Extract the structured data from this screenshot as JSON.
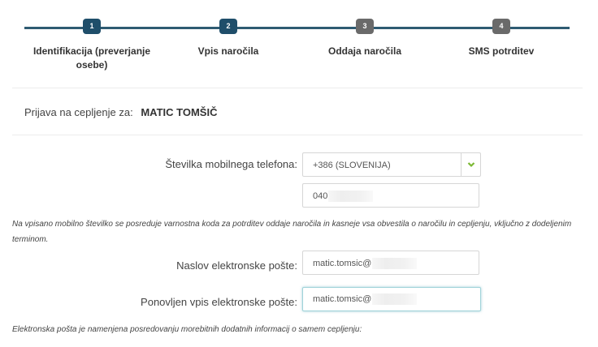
{
  "steps": [
    {
      "number": "1",
      "label": "Identifikacija (preverjanje osebe)",
      "active": true
    },
    {
      "number": "2",
      "label": "Vpis naročila",
      "active": true
    },
    {
      "number": "3",
      "label": "Oddaja naročila",
      "active": false
    },
    {
      "number": "4",
      "label": "SMS potrditev",
      "active": false
    }
  ],
  "registration": {
    "label": "Prijava na cepljenje za:",
    "name": "MATIC TOMŠIČ"
  },
  "phone": {
    "label": "Številka mobilnega telefona:",
    "country_value": "+386 (SLOVENIJA)",
    "number_value": "040"
  },
  "phone_note": "Na vpisano mobilno številko se posreduje varnostna koda za potrditev oddaje naročila in kasneje vsa obvestila o naročilu in cepljenju, vključno z dodeljenim terminom.",
  "email": {
    "label": "Naslov elektronske pošte:",
    "value": "matic.tomsic@",
    "repeat_label": "Ponovljen vpis elektronske pošte:",
    "repeat_value": "matic.tomsic@"
  },
  "email_note": "Elektronska pošta je namenjena posredovanju morebitnih dodatnih informacij o samem cepljenju:",
  "colors": {
    "step_line": "#2e5b72",
    "badge_active": "#1f4e6a",
    "badge_inactive": "#6a6a6a",
    "chevron": "#7bb833",
    "focus_border": "#9fd3d9"
  },
  "icons": {
    "select_arrow": "chevron-down-icon"
  }
}
